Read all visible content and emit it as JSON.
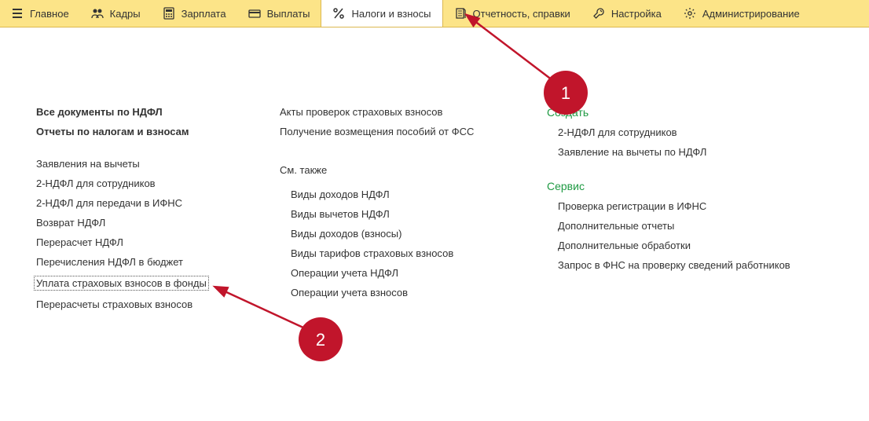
{
  "topbar": [
    {
      "icon": "menu",
      "label": "Главное"
    },
    {
      "icon": "people",
      "label": "Кадры"
    },
    {
      "icon": "calc",
      "label": "Зарплата"
    },
    {
      "icon": "card",
      "label": "Выплаты"
    },
    {
      "icon": "percent",
      "label": "Налоги и взносы",
      "active": true
    },
    {
      "icon": "report",
      "label": "Отчетность, справки"
    },
    {
      "icon": "wrench",
      "label": "Настройка"
    },
    {
      "icon": "gear",
      "label": "Администрирование"
    }
  ],
  "col1": {
    "bold": [
      "Все документы по НДФЛ",
      "Отчеты по налогам и взносам"
    ],
    "items": [
      "Заявления на вычеты",
      "2-НДФЛ для сотрудников",
      "2-НДФЛ для передачи в ИФНС",
      "Возврат НДФЛ",
      "Перерасчет НДФЛ",
      "Перечисления НДФЛ в бюджет",
      "Уплата страховых взносов в фонды",
      "Перерасчеты страховых взносов"
    ],
    "highlight_index": 6
  },
  "col2": {
    "top": [
      "Акты проверок страховых взносов",
      "Получение возмещения пособий от ФСС"
    ],
    "see_also_label": "См. также",
    "see_also": [
      "Виды доходов НДФЛ",
      "Виды вычетов НДФЛ",
      "Виды доходов (взносы)",
      "Виды тарифов страховых взносов",
      "Операции учета НДФЛ",
      "Операции учета взносов"
    ]
  },
  "col3": {
    "create_label": "Создать",
    "create_items": [
      "2-НДФЛ для сотрудников",
      "Заявление на вычеты по НДФЛ"
    ],
    "service_label": "Сервис",
    "service_items": [
      "Проверка регистрации в ИФНС",
      "Дополнительные отчеты",
      "Дополнительные обработки",
      "Запрос в ФНС на проверку сведений работников"
    ]
  },
  "annotations": {
    "badge1": "1",
    "badge2": "2"
  }
}
